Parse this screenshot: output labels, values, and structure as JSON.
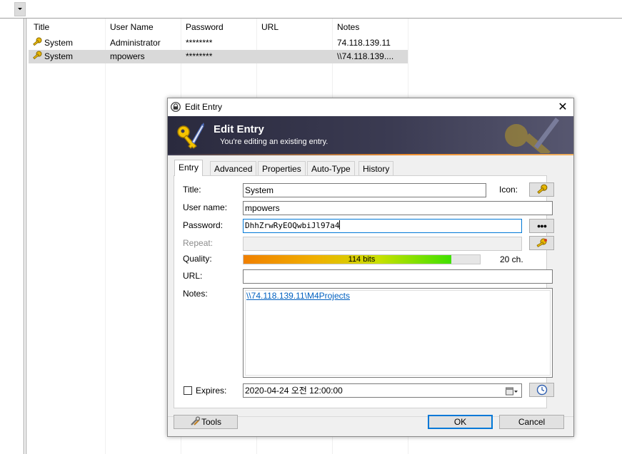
{
  "list": {
    "columns": [
      "Title",
      "User Name",
      "Password",
      "URL",
      "Notes"
    ],
    "rows": [
      {
        "title": "System",
        "username": "Administrator",
        "password": "********",
        "url": "",
        "notes": "74.118.139.11"
      },
      {
        "title": "System",
        "username": "mpowers",
        "password": "********",
        "url": "",
        "notes": "\\\\74.118.139...."
      }
    ]
  },
  "dialog": {
    "window_title": "Edit Entry",
    "close_symbol": "✕",
    "banner_title": "Edit Entry",
    "banner_subtitle": "You're editing an existing entry.",
    "tabs": [
      "Entry",
      "Advanced",
      "Properties",
      "Auto-Type",
      "History"
    ],
    "labels": {
      "title": "Title:",
      "icon": "Icon:",
      "username": "User name:",
      "password": "Password:",
      "repeat": "Repeat:",
      "quality": "Quality:",
      "url": "URL:",
      "notes": "Notes:",
      "expires": "Expires:"
    },
    "values": {
      "title": "System",
      "username": "mpowers",
      "password": "DhhZrwRyEOQwbiJl97a4",
      "repeat": "",
      "url": "",
      "notes": "\\\\74.118.139.11\\M4Projects",
      "expires": "2020-04-24 오전 12:00:00",
      "expires_checked": false
    },
    "quality": {
      "bits_text": "114 bits",
      "chars_text": "20 ch.",
      "fill_percent": 88
    },
    "password_toggle_symbol": "●●●",
    "buttons": {
      "tools": "Tools",
      "ok": "OK",
      "cancel": "Cancel"
    }
  }
}
